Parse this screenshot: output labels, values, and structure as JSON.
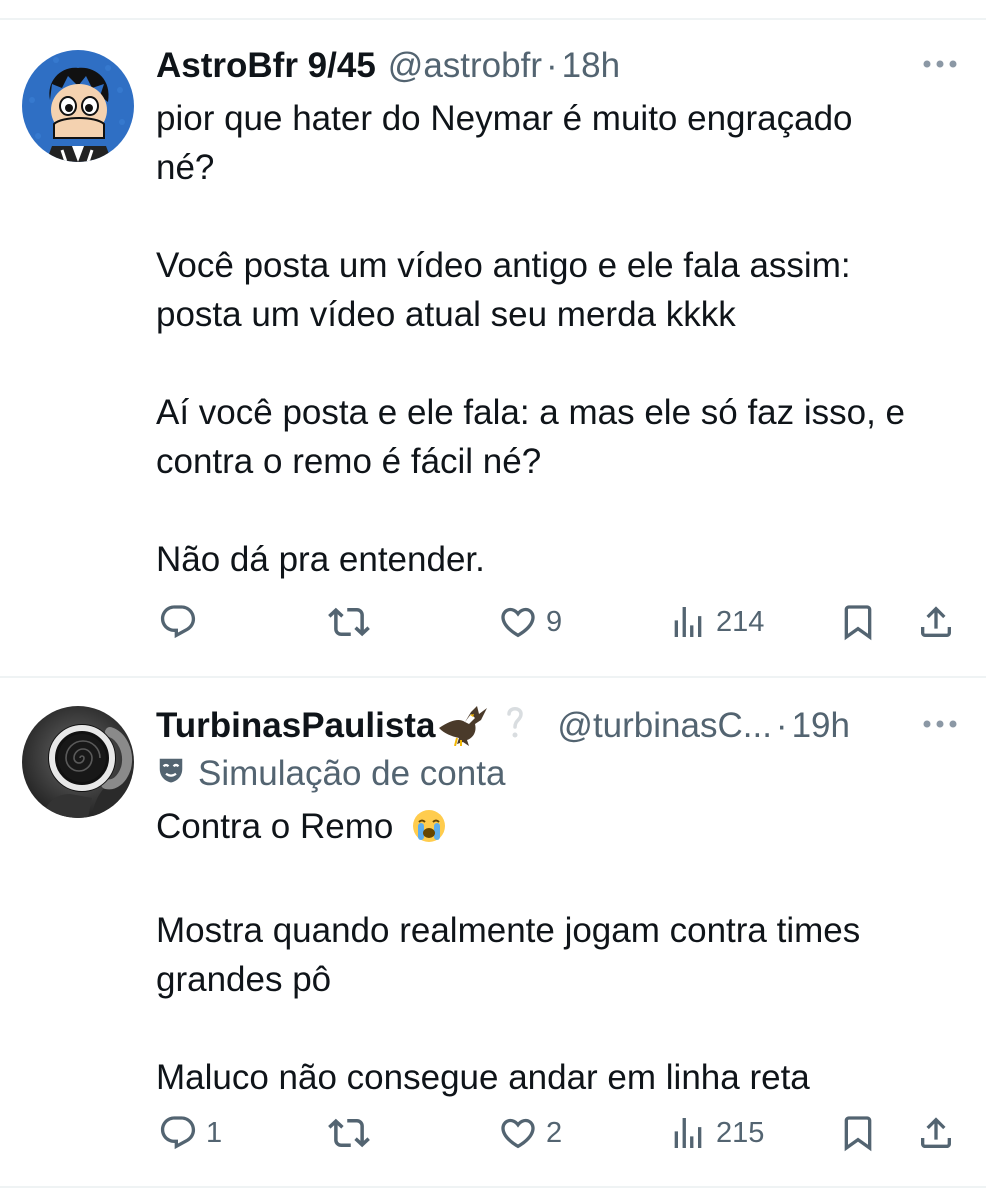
{
  "tweets": [
    {
      "author_name": "AstroBfr 9/45",
      "handle": "@astrobfr",
      "separator": "·",
      "time": "18h",
      "text": [
        "pior que hater do Neymar é muito engraçado",
        "né?",
        "Você posta um vídeo antigo e ele fala assim:",
        "posta um vídeo atual seu merda kkkk",
        "Aí você posta e ele fala: a mas ele só faz isso, e",
        "contra o remo é fácil né?",
        "Não dá pra entender."
      ],
      "replies": "",
      "retweets": "",
      "likes": "9",
      "views": "214"
    },
    {
      "author_name": "TurbinasPaulista",
      "handle": "@turbinasC...",
      "separator": "·",
      "time": "19h",
      "label": "Simulação de conta",
      "text": [
        "Contra o Remo",
        "Mostra quando realmente jogam contra times",
        "grandes pô",
        "Maluco não consegue andar em linha reta"
      ],
      "replies": "1",
      "retweets": "",
      "likes": "2",
      "views": "215"
    }
  ],
  "icons": {
    "more": "more-icon",
    "reply": "reply-icon",
    "retweet": "retweet-icon",
    "like": "like-icon",
    "views": "views-icon",
    "bookmark": "bookmark-icon",
    "share": "share-icon",
    "eagle_emoji": "eagle-emoji-icon",
    "question": "question-icon",
    "mask": "parody-mask-icon",
    "crying_emoji": "crying-emoji-icon"
  },
  "colors": {
    "text": "#0f1419",
    "secondary": "#536471",
    "divider": "#eff3f4"
  }
}
